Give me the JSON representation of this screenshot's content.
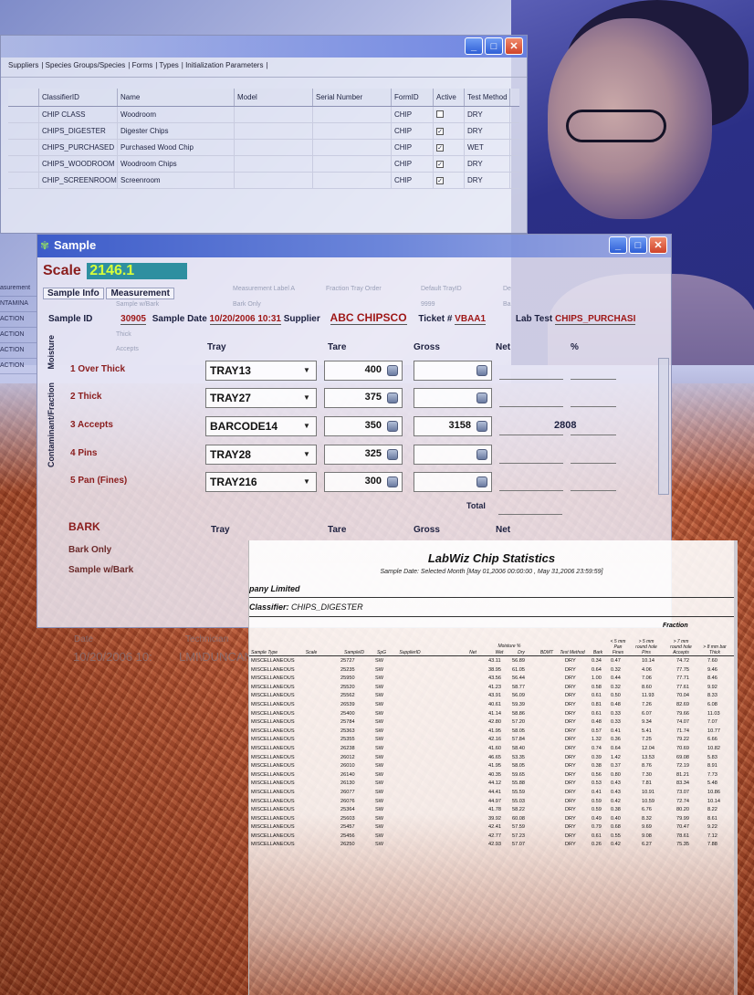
{
  "window_classifier": {
    "tabs": [
      "Suppliers",
      "Species Groups/Species",
      "Forms",
      "Types",
      "Initialization Parameters"
    ],
    "columns": [
      "ClassifierID",
      "Name",
      "Model",
      "Serial Number",
      "FormID",
      "Active",
      "Test Method"
    ],
    "rows": [
      {
        "id": "CHIP CLASS",
        "name": "Woodroom",
        "form": "CHIP",
        "active": false,
        "method": "DRY"
      },
      {
        "id": "CHIPS_DIGESTER",
        "name": "Digester Chips",
        "form": "CHIP",
        "active": true,
        "method": "DRY"
      },
      {
        "id": "CHIPS_PURCHASED",
        "name": "Purchased Wood Chip",
        "form": "CHIP",
        "active": true,
        "method": "WET"
      },
      {
        "id": "CHIPS_WOODROOM",
        "name": "Woodroom Chips",
        "form": "CHIP",
        "active": true,
        "method": "DRY"
      },
      {
        "id": "CHIP_SCREENROOM",
        "name": "Screenroom",
        "form": "CHIP",
        "active": true,
        "method": "DRY"
      }
    ]
  },
  "hidden_window_strip": [
    "asurement",
    "NTAMINA",
    "ACTION",
    "ACTION",
    "ACTION",
    "ACTION"
  ],
  "window_sample": {
    "title": "Sample",
    "scale_label": "Scale",
    "scale_value": "2146.1",
    "tabs": [
      "Sample Info",
      "Measurement"
    ],
    "ghost_headers": [
      "Measurement Label A",
      "Fraction Tray Order",
      "Default TrayID",
      "De"
    ],
    "ghost_values": [
      "Sample w/Bark",
      "Bark Only",
      "Thick",
      "Accepts",
      "9999",
      "Ba"
    ],
    "sample_id_label": "Sample ID",
    "sample_id": "30905",
    "sample_date_label": "Sample Date",
    "sample_date": "10/20/2006 10:31",
    "supplier_label": "Supplier",
    "supplier": "ABC CHIPSCO",
    "ticket_label": "Ticket #",
    "ticket": "VBAA1",
    "lab_test_label": "Lab Test",
    "lab_test": "CHIPS_PURCHASI",
    "side_tabs": [
      "Moisture",
      "Contaminant/Fraction"
    ],
    "col_tray": "Tray",
    "col_tare": "Tare",
    "col_gross": "Gross",
    "col_net": "Net",
    "col_pct": "%",
    "rows": [
      {
        "label": "1 Over Thick",
        "tray": "TRAY13",
        "tare": "400",
        "gross": "",
        "net": ""
      },
      {
        "label": "2 Thick",
        "tray": "TRAY27",
        "tare": "375",
        "gross": "",
        "net": ""
      },
      {
        "label": "3 Accepts",
        "tray": "BARCODE14",
        "tare": "350",
        "gross": "3158",
        "net": "2808"
      },
      {
        "label": "4 Pins",
        "tray": "TRAY28",
        "tare": "325",
        "gross": "",
        "net": ""
      },
      {
        "label": "5 Pan (Fines)",
        "tray": "TRAY216",
        "tare": "300",
        "gross": "",
        "net": ""
      }
    ],
    "total_label": "Total",
    "bark_label": "BARK",
    "bark_rows": [
      "Bark Only",
      "Sample w/Bark"
    ],
    "faded_labels": [
      "Date",
      "Technician",
      "10/20/2006 10:",
      "LMI\\DUNCAN"
    ]
  },
  "report": {
    "title": "LabWiz Chip Statistics",
    "subtitle": "Sample Date: Selected Month [May 01,2006 00:00:00 , May 31,2006 23:59:59]",
    "company": "pany Limited",
    "classifier_label": "Classifier:",
    "classifier": "CHIPS_DIGESTER",
    "fraction_header": "Fraction",
    "headers": {
      "sample_type": "Sample Type",
      "scale": "Scale",
      "sample_id": "SampleID",
      "spg": "SpG",
      "supplier": "SupplierID",
      "net": "Net",
      "moisture": "Moisture %",
      "wet": "Wet",
      "dry": "Dry",
      "bdmt": "BDMT",
      "test_method": "Test Method",
      "bark": "Bark",
      "pan": "< 5 mm Pan Fines",
      "pins": "> 5 mm round hole Pins",
      "accepts": "> 7 mm round hole Accepts",
      "bar": "> 8 mm bar Thick"
    },
    "rows": [
      [
        "MISCELLANEOUS",
        "25727",
        "SW",
        "43.11",
        "56.89",
        "DRY",
        "0.34",
        "0.47",
        "10.14",
        "74.72",
        "7.60"
      ],
      [
        "MISCELLANEOUS",
        "25235",
        "SW",
        "38.95",
        "61.05",
        "DRY",
        "0.64",
        "0.32",
        "4.06",
        "77.75",
        "9.46"
      ],
      [
        "MISCELLANEOUS",
        "25950",
        "SW",
        "43.56",
        "56.44",
        "DRY",
        "1.00",
        "0.44",
        "7.06",
        "77.71",
        "8.46"
      ],
      [
        "MISCELLANEOUS",
        "25520",
        "SW",
        "41.23",
        "58.77",
        "DRY",
        "0.58",
        "0.32",
        "8.60",
        "77.61",
        "9.92"
      ],
      [
        "MISCELLANEOUS",
        "25562",
        "SW",
        "43.91",
        "56.09",
        "DRY",
        "0.61",
        "0.50",
        "11.93",
        "70.04",
        "8.33"
      ],
      [
        "MISCELLANEOUS",
        "26539",
        "SW",
        "40.61",
        "59.39",
        "DRY",
        "0.81",
        "0.48",
        "7.26",
        "82.69",
        "6.08"
      ],
      [
        "MISCELLANEOUS",
        "25400",
        "SW",
        "41.14",
        "58.86",
        "DRY",
        "0.61",
        "0.33",
        "6.07",
        "79.66",
        "11.03"
      ],
      [
        "MISCELLANEOUS",
        "25784",
        "SW",
        "42.80",
        "57.20",
        "DRY",
        "0.48",
        "0.33",
        "9.34",
        "74.07",
        "7.07"
      ],
      [
        "MISCELLANEOUS",
        "25363",
        "SW",
        "41.95",
        "58.05",
        "DRY",
        "0.57",
        "0.41",
        "5.41",
        "71.74",
        "10.77"
      ],
      [
        "MISCELLANEOUS",
        "25355",
        "SW",
        "42.16",
        "57.84",
        "DRY",
        "1.32",
        "0.36",
        "7.25",
        "79.22",
        "6.66"
      ],
      [
        "MISCELLANEOUS",
        "26238",
        "SW",
        "41.60",
        "58.40",
        "DRY",
        "0.74",
        "0.64",
        "12.04",
        "70.69",
        "10.82"
      ],
      [
        "MISCELLANEOUS",
        "26012",
        "SW",
        "46.65",
        "53.35",
        "DRY",
        "0.39",
        "1.42",
        "13.53",
        "69.08",
        "5.83"
      ],
      [
        "MISCELLANEOUS",
        "26010",
        "SW",
        "41.95",
        "58.05",
        "DRY",
        "0.38",
        "0.37",
        "8.76",
        "72.19",
        "8.91"
      ],
      [
        "MISCELLANEOUS",
        "26140",
        "SW",
        "40.35",
        "59.65",
        "DRY",
        "0.56",
        "0.80",
        "7.30",
        "81.21",
        "7.73"
      ],
      [
        "MISCELLANEOUS",
        "26130",
        "SW",
        "44.12",
        "55.88",
        "DRY",
        "0.53",
        "0.43",
        "7.81",
        "83.34",
        "5.48"
      ],
      [
        "MISCELLANEOUS",
        "26077",
        "SW",
        "44.41",
        "55.59",
        "DRY",
        "0.41",
        "0.43",
        "10.91",
        "73.07",
        "10.86"
      ],
      [
        "MISCELLANEOUS",
        "26076",
        "SW",
        "44.97",
        "55.03",
        "DRY",
        "0.59",
        "0.42",
        "10.59",
        "72.74",
        "10.14"
      ],
      [
        "MISCELLANEOUS",
        "25364",
        "SW",
        "41.78",
        "58.22",
        "DRY",
        "0.59",
        "0.38",
        "6.76",
        "80.20",
        "8.22"
      ],
      [
        "MISCELLANEOUS",
        "25603",
        "SW",
        "39.92",
        "60.08",
        "DRY",
        "0.49",
        "0.40",
        "8.32",
        "79.99",
        "8.61"
      ],
      [
        "MISCELLANEOUS",
        "25457",
        "SW",
        "42.41",
        "57.59",
        "DRY",
        "0.79",
        "0.68",
        "9.69",
        "70.47",
        "9.22"
      ],
      [
        "MISCELLANEOUS",
        "25456",
        "SW",
        "42.77",
        "57.23",
        "DRY",
        "0.61",
        "0.55",
        "9.08",
        "78.61",
        "7.12"
      ],
      [
        "MISCELLANEOUS",
        "26250",
        "SW",
        "42.93",
        "57.07",
        "DRY",
        "0.26",
        "0.42",
        "6.27",
        "75.35",
        "7.88"
      ]
    ]
  }
}
